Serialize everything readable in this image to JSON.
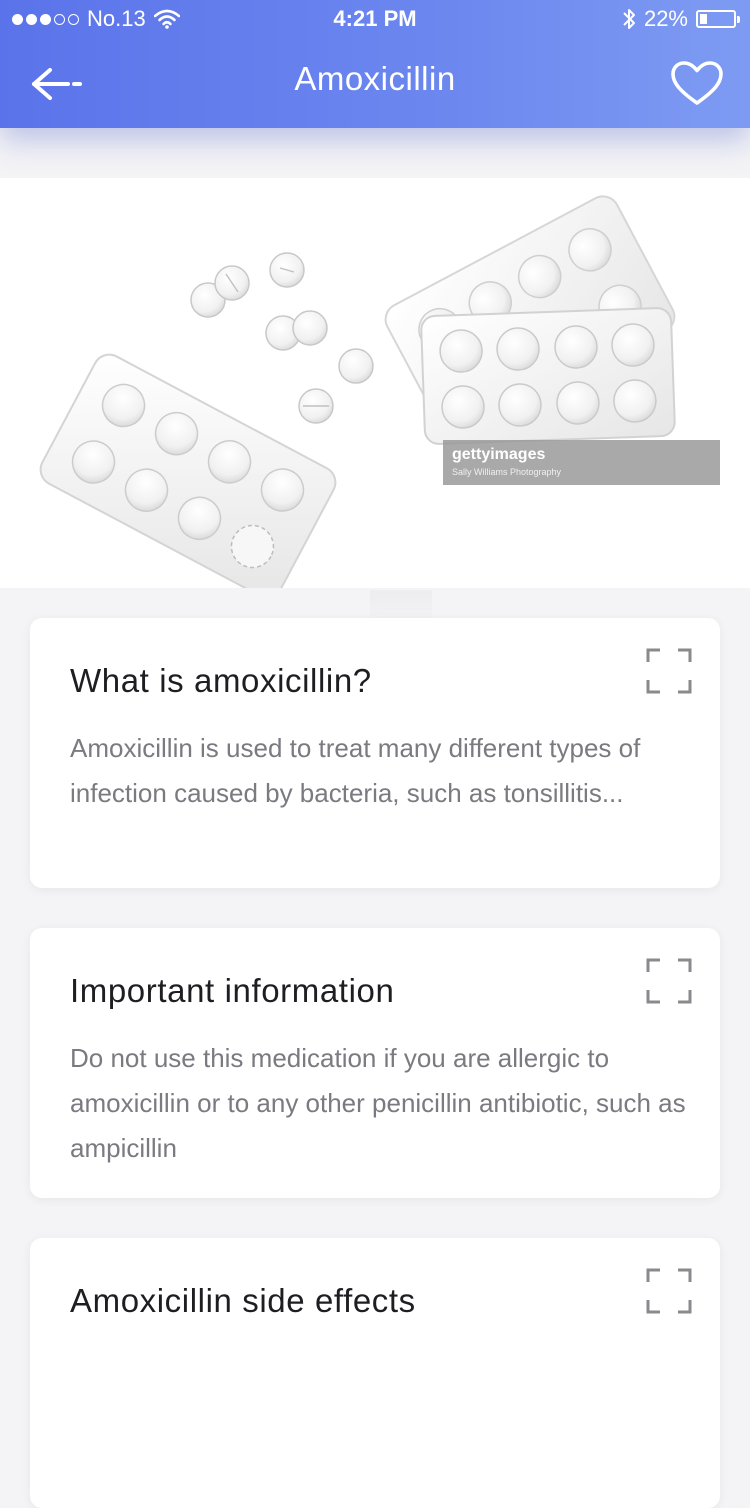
{
  "status_bar": {
    "carrier": "No.13",
    "time": "4:21 PM",
    "battery_text": "22%",
    "battery_level": 0.22
  },
  "nav": {
    "title": "Amoxicillin",
    "back_icon": "back-arrow-icon",
    "favorite_icon": "heart-outline-icon"
  },
  "hero_image": {
    "watermark_brand": "gettyimages",
    "watermark_credit": "Sally Williams Photography"
  },
  "cards": [
    {
      "title": "What is amoxicillin?",
      "body": "Amoxicillin is used to treat many different types of infection caused by bacteria, such as tonsillitis...",
      "icon": "expand-icon"
    },
    {
      "title": "Important information",
      "body": "Do not use this medication if you are allergic to amoxicillin or to any other penicillin antibiotic, such as ampicillin",
      "icon": "expand-icon"
    },
    {
      "title": "Amoxicillin side effects",
      "body": "",
      "icon": "expand-icon"
    }
  ],
  "colors": {
    "header_start": "#5b73ea",
    "header_end": "#7e9bf3",
    "card_title": "#1e1e22",
    "card_body": "#7a7a80",
    "page_bg": "#f4f4f6"
  }
}
